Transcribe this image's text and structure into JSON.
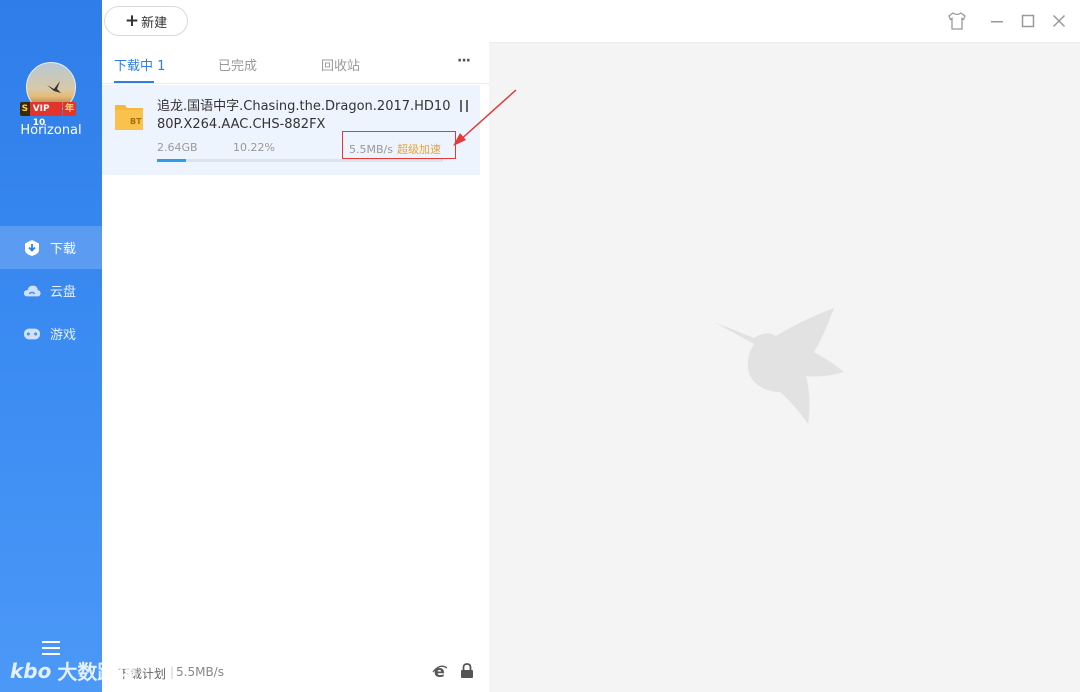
{
  "user": {
    "name": "Horizonal",
    "vip_badge": "VIP 10",
    "vip_year": "年",
    "vip_s": "S"
  },
  "sidebar": {
    "items": [
      {
        "label": "下载",
        "icon": "download-shield-icon",
        "active": true
      },
      {
        "label": "云盘",
        "icon": "cloud-icon",
        "active": false
      },
      {
        "label": "游戏",
        "icon": "gamepad-icon",
        "active": false
      }
    ]
  },
  "toolbar": {
    "new_label": "新建"
  },
  "tabs": [
    {
      "label": "下载中 1",
      "active": true
    },
    {
      "label": "已完成",
      "active": false
    },
    {
      "label": "回收站",
      "active": false
    }
  ],
  "more_label": "···",
  "task": {
    "name": "追龙.国语中字.Chasing.the.Dragon.2017.HD1080P.X264.AAC.CHS-882FX",
    "size": "2.64GB",
    "percent": "10.22%",
    "progress": 0.1022,
    "speed": "5.5MB/s",
    "boost": "超级加速",
    "file_badge": "BT"
  },
  "bottom": {
    "plan": "下载计划",
    "sep": "|",
    "speed": "5.5MB/s"
  },
  "watermark": {
    "text": "大数跨境"
  },
  "colors": {
    "accent": "#2f7de9",
    "sidebar": "#3a8bf2",
    "boost": "#e8a33a",
    "highlight": "#e23a3a"
  }
}
